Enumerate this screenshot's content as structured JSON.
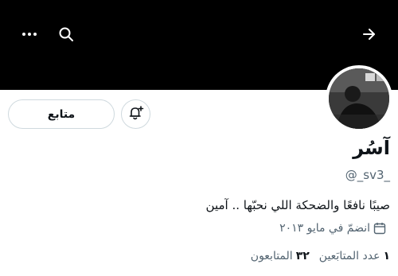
{
  "header": {
    "more_icon": "more-horizontal-icon",
    "search_icon": "search-icon",
    "back_icon": "arrow-icon"
  },
  "colors": {
    "banner": "#000000",
    "text_primary": "#0f1419",
    "text_secondary": "#536471",
    "border": "#cfd9de"
  },
  "profile": {
    "display_name": "آسُر",
    "handle": "@_sv3_",
    "bio": "صيبًا نافعًا والضحكة اللي نحبّها .. آمين",
    "joined": "انضمّ في مايو ٢٠١٣",
    "joined_icon": "calendar-icon"
  },
  "actions": {
    "follow_label": "متابع",
    "notify_icon": "bell-plus-icon"
  },
  "stats": {
    "following_count": "١",
    "following_label": "عدد المتابَعين",
    "followers_count": "٣٢",
    "followers_label": "المتابعون"
  }
}
